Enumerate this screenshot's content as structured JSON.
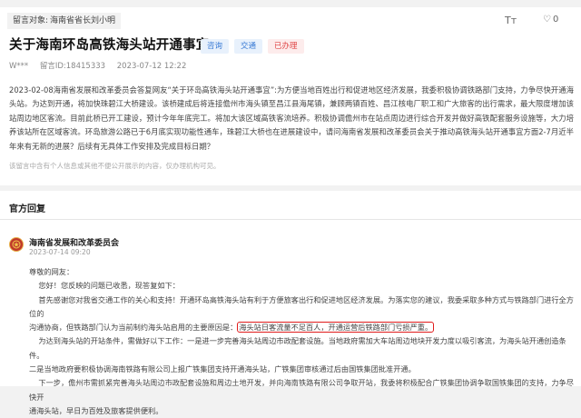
{
  "recipient": {
    "label": "留言对象:",
    "value": "海南省省长刘小明"
  },
  "toolbar": {
    "font_size_icon": "Tт",
    "like_count": "0"
  },
  "message": {
    "title": "关于海南环岛高铁海头站开通事宜",
    "tags": [
      "咨询",
      "交通",
      "已办理"
    ],
    "author": "W***",
    "message_id": "留言ID:18415333",
    "timestamp": "2023-07-12 12:22",
    "content": "2023-02-08海南省发展和改革委员会答复网友“关于环岛高铁海头站开通事宜”:为方便当地百姓出行和促进地区经济发展，我委积极协调铁路部门支持，力争尽快开通海头站。为达到开通，将加快珠碧江大桥建设。该桥建成后将连接儋州市海头镇至昌江县海尾镇，兼顾两镇百姓、昌江核电厂职工和广大旅客的出行需求，最大限度增加该站周边地区客流。目前此桥已开工建设，预计今年年底完工。将加大该区域高铁客流培养。积极协调儋州市在站点周边进行综合开发并做好高铁配套服务设施等，大力培养该站所在区域客流。环岛旅游公路已于6月底实现功能性通车，珠碧江大桥也在进展建设中，请问海南省发展和改革委员会关于推动高铁海头站开通事宜方面2-7月近半年来有无新的进展？后续有无具体工作安排及完成目标日期？",
    "disclaimer": "该留言中含有个人信息或其他不便公开展示的内容，仅办理机构可见。"
  },
  "reply": {
    "section_title": "官方回复",
    "department": "海南省发展和改革委员会",
    "date": "2023-07-14 09:20",
    "greeting": "尊敬的网友：",
    "p1": "您好！您反映的问题已收悉，现答复如下：",
    "p2": "首先感谢您对我省交通工作的关心和支持！开通环岛高铁海头站有利于方便旅客出行和促进地区经济发展。为落实您的建议，我委采取多种方式与铁路部门进行全方位的",
    "p2b_pre": "沟通协商，但铁路部门认为当前制约海头站启用的主要原因是：",
    "p2b_hl": "海头站日客流量不足百人，开通运营后铁路部门亏损严重。",
    "p3": "为达到海头站的开站条件，需做好以下工作：一是进一步完善海头站周边市政配套设施。当地政府需加大车站周边地块开发力度以吸引客流，为海头站开通创造条件。",
    "p3b": "二是当地政府要积极协调海南铁路有限公司上报广铁集团支持开通海头站，广铁集团审核通过后由国铁集团批准开通。",
    "p4": "下一步，儋州市需抓紧完善海头站周边市政配套设施和周边土地开发，并向海南铁路有限公司争取开站，我委将积极配合广铁集团协调争取国铁集团的支持，力争尽快开",
    "p4b": "通海头站，早日为百姓及旅客提供便利。"
  },
  "colors": {
    "tag_blue": "#3a7bd5",
    "tag_red": "#e04848",
    "highlight": "#e01b1b",
    "dept_logo": "#c0392b"
  }
}
